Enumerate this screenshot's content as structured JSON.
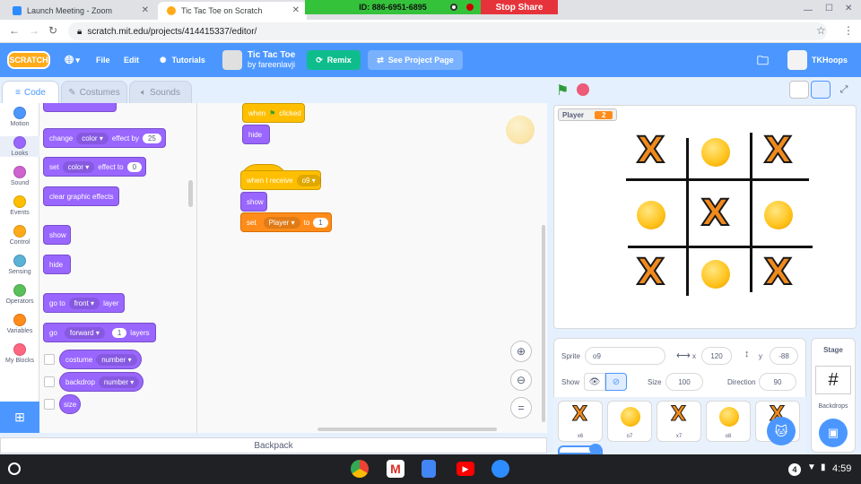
{
  "browser": {
    "tabs": [
      {
        "title": "Launch Meeting - Zoom"
      },
      {
        "title": "Tic Tac Toe on Scratch"
      }
    ],
    "url": "scratch.mit.edu/projects/414415337/editor/"
  },
  "zoom_share": {
    "id_text": "ID: 886-6951-6895",
    "stop_label": "Stop Share"
  },
  "menubar": {
    "logo": "SCRATCH",
    "file": "File",
    "edit": "Edit",
    "tutorials": "Tutorials",
    "project_title": "Tic Tac Toe",
    "author": "by fareenlavji",
    "remix": "Remix",
    "see_project_page": "See Project Page",
    "username": "TKHoops"
  },
  "editor_tabs": [
    "Code",
    "Costumes",
    "Sounds"
  ],
  "categories": [
    {
      "label": "Motion",
      "color": "#4c97ff"
    },
    {
      "label": "Looks",
      "color": "#9966ff"
    },
    {
      "label": "Sound",
      "color": "#cf63cf"
    },
    {
      "label": "Events",
      "color": "#ffbf00"
    },
    {
      "label": "Control",
      "color": "#ffab19"
    },
    {
      "label": "Sensing",
      "color": "#5cb1d6"
    },
    {
      "label": "Operators",
      "color": "#59c059"
    },
    {
      "label": "Variables",
      "color": "#ff8c1a"
    },
    {
      "label": "My Blocks",
      "color": "#ff6680"
    }
  ],
  "palette": {
    "change_effect": {
      "pre": "change",
      "dd": "color",
      "mid": "effect by",
      "num": "25"
    },
    "set_effect": {
      "pre": "set",
      "dd": "color",
      "mid": "effect to",
      "num": "0"
    },
    "clear_effects": "clear graphic effects",
    "show": "show",
    "hide": "hide",
    "goto_layer": {
      "pre": "go to",
      "dd": "front",
      "post": "layer"
    },
    "go_layers": {
      "pre": "go",
      "dd": "forward",
      "num": "1",
      "post": "layers"
    },
    "costume": {
      "pre": "costume",
      "dd": "number"
    },
    "backdrop": {
      "pre": "backdrop",
      "dd": "number"
    },
    "size": "size"
  },
  "scripts": {
    "s1_hat": {
      "pre": "when",
      "post": "clicked"
    },
    "s1_hide": "hide",
    "s2_hat": {
      "pre": "when I receive",
      "dd": "o9"
    },
    "s2_show": "show",
    "s2_set": {
      "pre": "set",
      "dd": "Player",
      "mid": "to",
      "num": "1"
    }
  },
  "stage_monitor": {
    "label": "Player",
    "value": "2"
  },
  "board": [
    [
      "X",
      "O",
      "X"
    ],
    [
      "O",
      "X",
      "O"
    ],
    [
      "X",
      "O",
      "X"
    ]
  ],
  "sprite_info": {
    "sprite_label": "Sprite",
    "sprite_name": "o9",
    "x_label": "x",
    "x": "120",
    "y_label": "y",
    "y": "-88",
    "show_label": "Show",
    "size_label": "Size",
    "size": "100",
    "direction_label": "Direction",
    "direction": "90"
  },
  "sprites": [
    {
      "name": "x6",
      "kind": "X"
    },
    {
      "name": "o7",
      "kind": "O"
    },
    {
      "name": "x7",
      "kind": "X"
    },
    {
      "name": "o8",
      "kind": "O"
    },
    {
      "name": "x8",
      "kind": "X"
    }
  ],
  "stage_panel": {
    "title": "Stage",
    "backdrops": "Backdrops"
  },
  "backpack": "Backpack",
  "taskbar": {
    "time": "4:59",
    "notifications": "4"
  }
}
